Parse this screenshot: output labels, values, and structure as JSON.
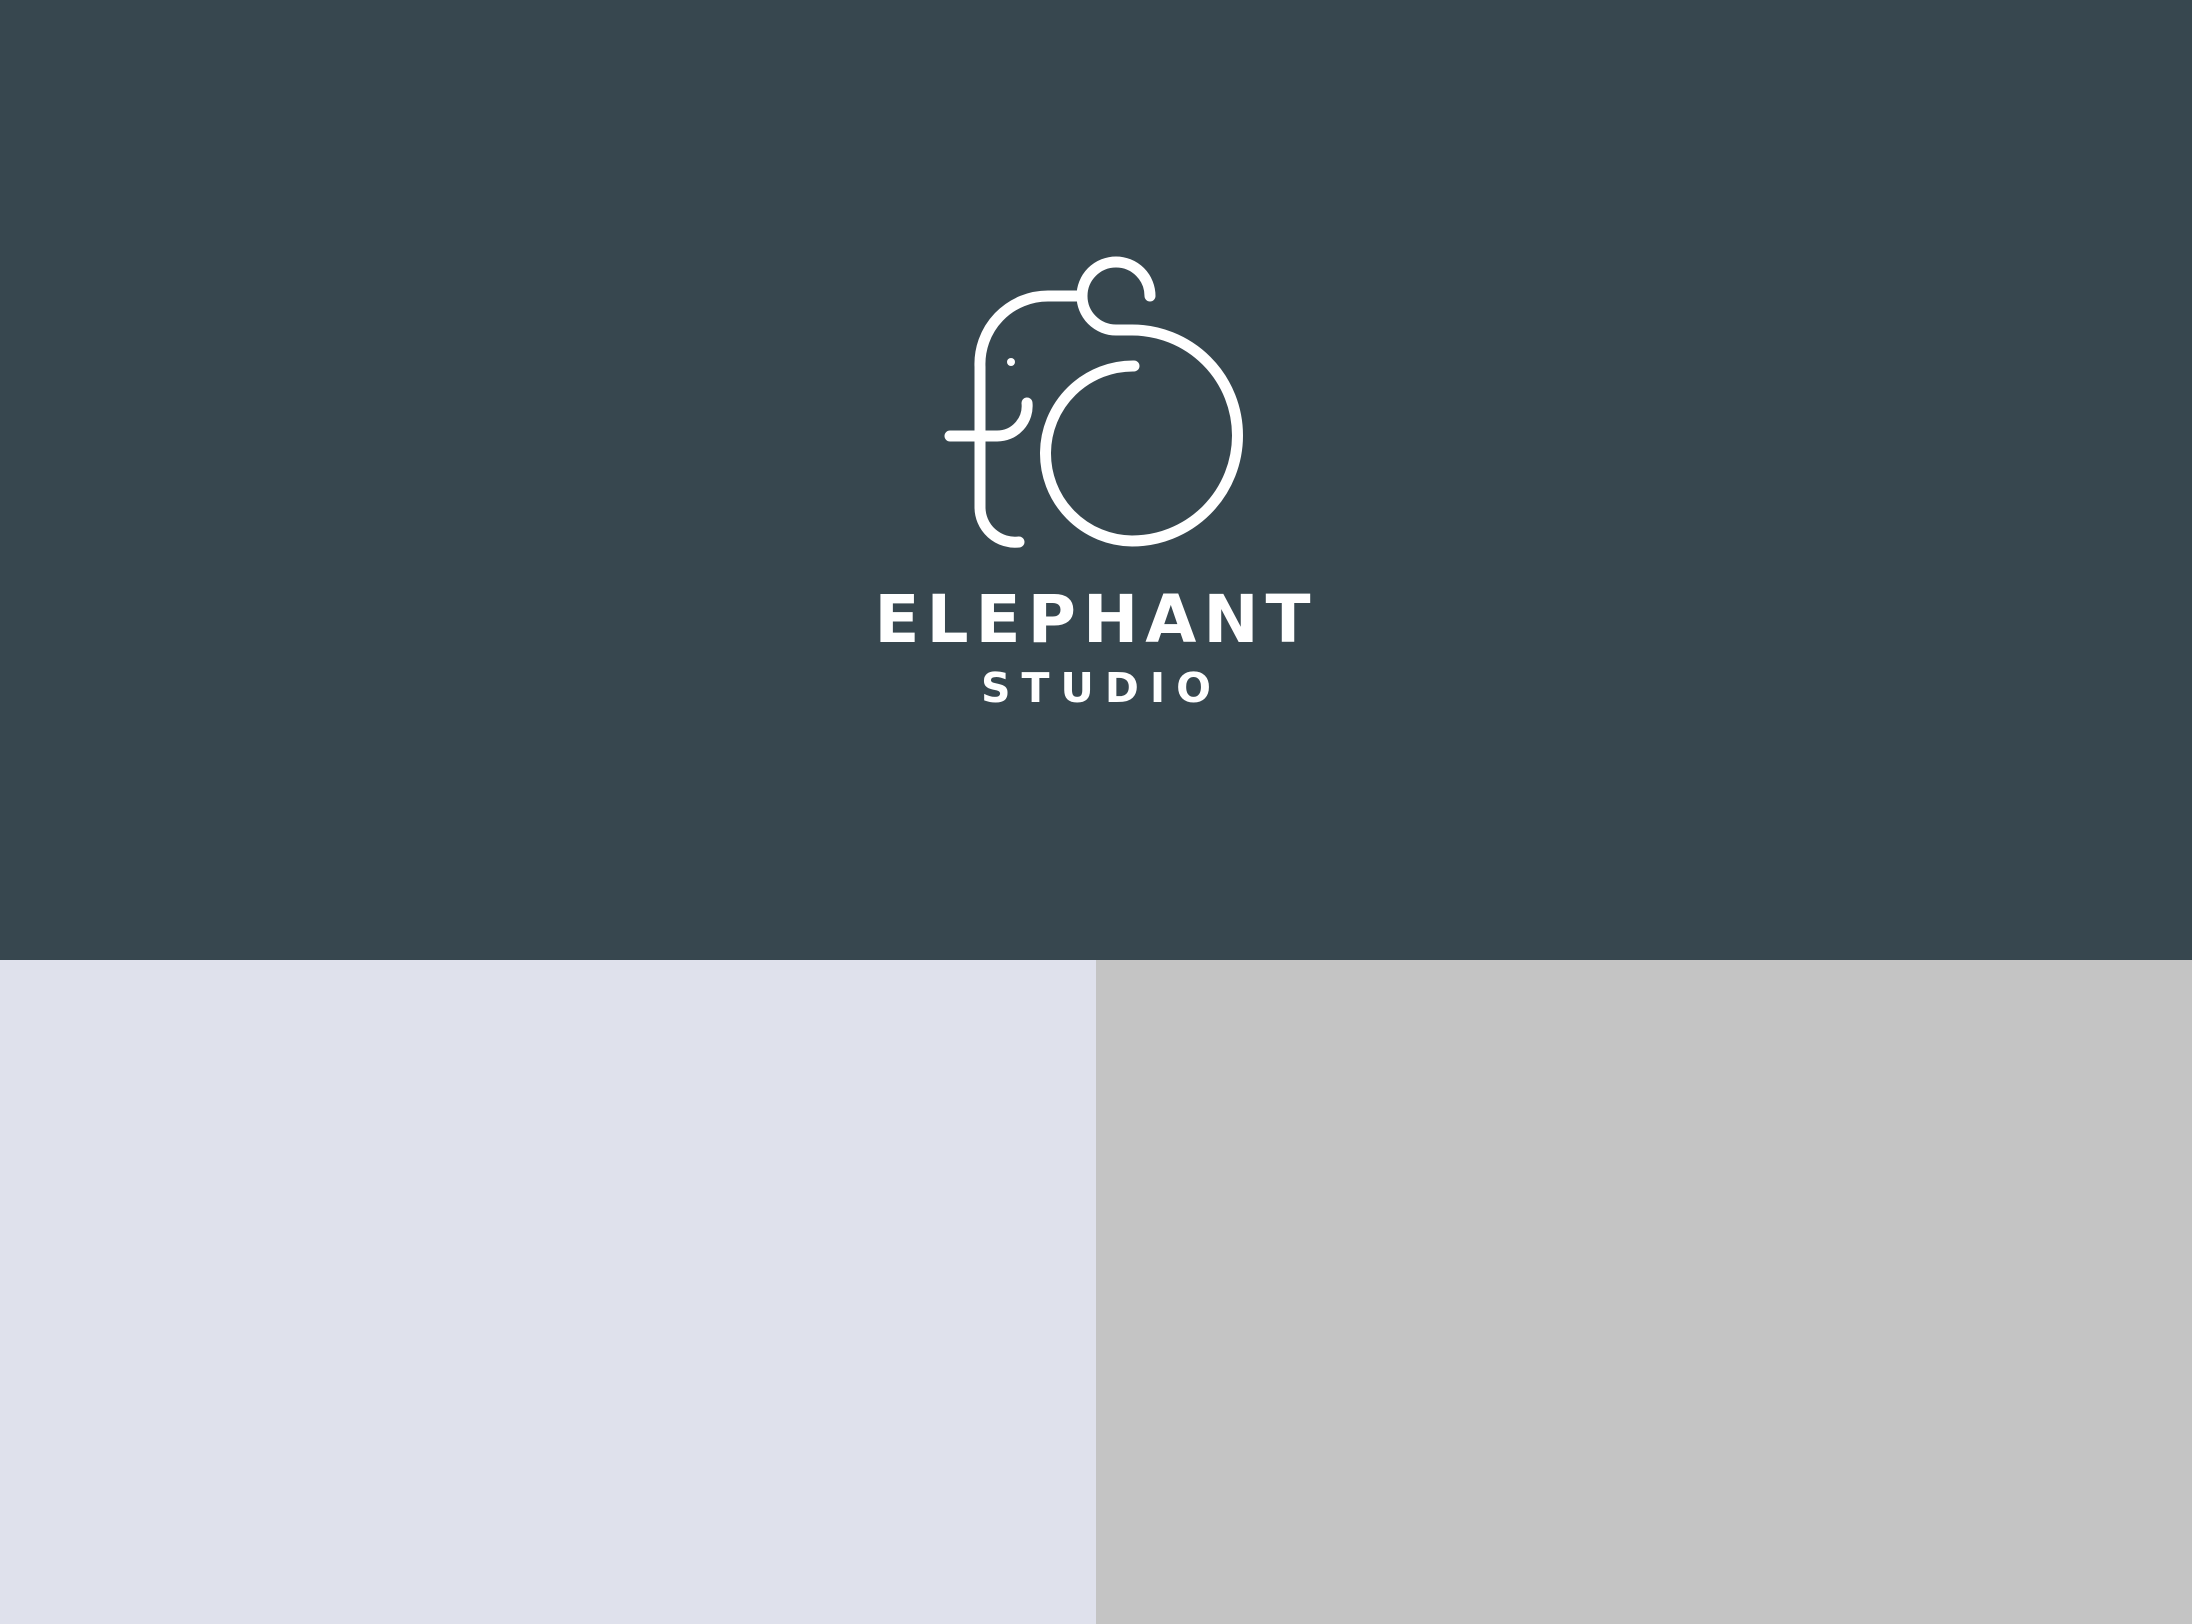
{
  "brand": {
    "name": "ELEPHANT",
    "subtitle": "STUDIO",
    "logo_icon": "elephant-line-icon"
  },
  "colors": {
    "top_background": "#37474f",
    "bottom_left_background": "#dfe1ec",
    "bottom_right_background": "#c4c4c4",
    "logo_color": "#ffffff"
  }
}
